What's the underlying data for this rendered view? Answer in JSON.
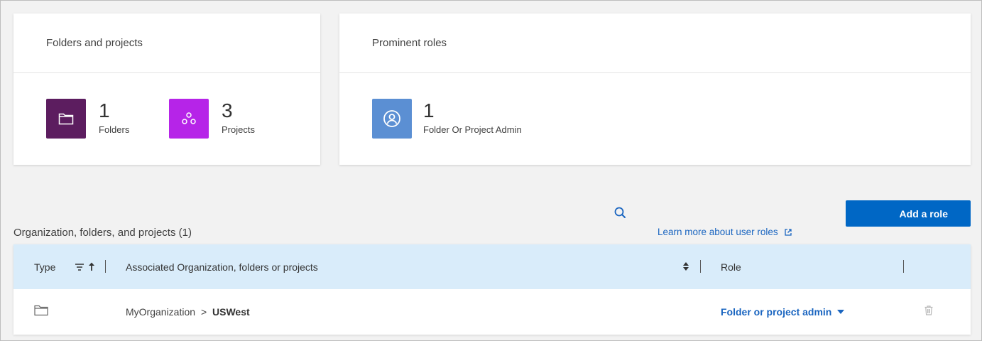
{
  "cards": {
    "folders_projects": {
      "title": "Folders and projects",
      "folders": {
        "count": "1",
        "label": "Folders",
        "icon": "folder-icon",
        "color": "#5c1d5f"
      },
      "projects": {
        "count": "3",
        "label": "Projects",
        "icon": "projects-icon",
        "color": "#b624e8"
      }
    },
    "prominent_roles": {
      "title": "Prominent roles",
      "role": {
        "count": "1",
        "label": "Folder Or Project Admin",
        "icon": "user-circle-icon",
        "color": "#5b8fd3"
      }
    }
  },
  "section": {
    "title": "Organization, folders, and projects (1)",
    "learn_more": "Learn more about user roles",
    "add_role": "Add a role"
  },
  "table": {
    "columns": [
      "Type",
      "Associated Organization, folders or projects",
      "Role"
    ],
    "rows": [
      {
        "type_icon": "folder-icon",
        "path_prefix": "MyOrganization",
        "path_sep": ">",
        "path_name": "USWest",
        "role": "Folder or project admin"
      }
    ]
  },
  "colors": {
    "accent": "#0067c5",
    "link": "#1a65c0",
    "table_header_bg": "#d9ecfa"
  }
}
